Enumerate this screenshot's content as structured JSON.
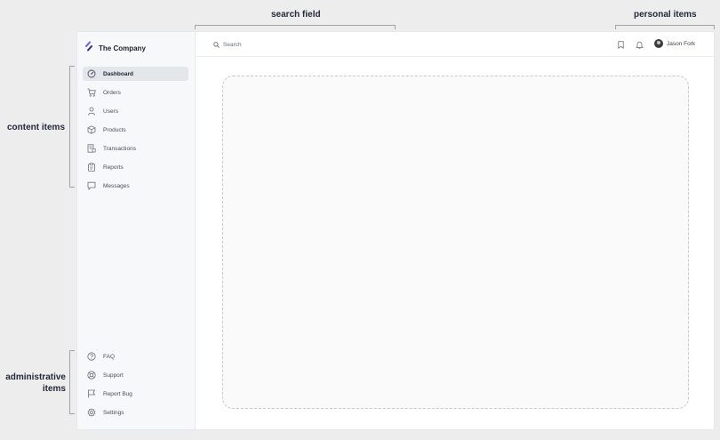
{
  "annotations": {
    "search_field": "search field",
    "personal_items": "personal items",
    "content_items": "content items",
    "administrative_items_line1": "administrative",
    "administrative_items_line2": "items"
  },
  "brand": {
    "name": "The Company",
    "logo_icon": "logo-icon"
  },
  "header": {
    "search_placeholder": "Search",
    "search_icon": "search-icon",
    "bookmark_icon": "bookmark-icon",
    "bell_icon": "bell-icon",
    "user_name": "Jason Fork"
  },
  "sidebar": {
    "content_items": [
      {
        "label": "Dashboard",
        "icon": "dashboard-icon",
        "active": true
      },
      {
        "label": "Orders",
        "icon": "cart-icon"
      },
      {
        "label": "Users",
        "icon": "user-icon"
      },
      {
        "label": "Products",
        "icon": "box-icon"
      },
      {
        "label": "Transactions",
        "icon": "transactions-icon"
      },
      {
        "label": "Reports",
        "icon": "clipboard-icon"
      },
      {
        "label": "Messages",
        "icon": "message-icon"
      }
    ],
    "admin_items": [
      {
        "label": "FAQ",
        "icon": "help-icon"
      },
      {
        "label": "Support",
        "icon": "support-icon"
      },
      {
        "label": "Report Bug",
        "icon": "flag-icon"
      },
      {
        "label": "Settings",
        "icon": "gear-icon"
      }
    ]
  },
  "colors": {
    "brand_accent": "#6b5ce7",
    "active_bg": "#e3e6ea",
    "sidebar_bg": "#f6f8fa"
  }
}
